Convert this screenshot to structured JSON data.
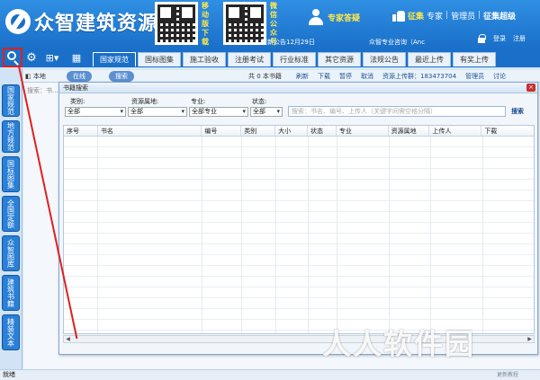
{
  "header": {
    "logo_text": "众智建筑资源",
    "qr1_label": "移动版下载",
    "qr2_label": "微信公众号",
    "expert_label": "专家答疑",
    "recruit_label": "征集",
    "recruit_expert": "专家",
    "recruit_admin": "管理员",
    "recruit_super": "征集超级",
    "notice": "更新公告12月29日",
    "company": "众智专业咨询（Anc",
    "login": "登录",
    "register": "注册"
  },
  "nav": {
    "tabs": [
      "国家规范",
      "国标图集",
      "施工验收",
      "注册考试",
      "行业标准",
      "其它资源",
      "法规公告",
      "最近上传",
      "有奖上传"
    ],
    "active": 0
  },
  "subbar": {
    "tab_label": "本地",
    "online_label": "在线",
    "search_label": "搜索",
    "count_text": "共 0 本书籍",
    "actions": [
      "刷新",
      "下载",
      "暂停",
      "取消"
    ],
    "uploader_label": "资源上传群：183473704",
    "admin_label": "管理员",
    "discuss_label": "讨论"
  },
  "sidebar": {
    "tabs": [
      "国家规范",
      "地方规范",
      "国标图集",
      "全国定额",
      "众智图库",
      "建筑书籍",
      "精装文本"
    ]
  },
  "background": {
    "search_placeholder": "搜索：书..."
  },
  "dialog": {
    "title": "书籍搜索",
    "close": "×",
    "filters": {
      "category_label": "类别:",
      "category_value": "全部",
      "region_label": "资源属地:",
      "region_value": "全部",
      "major_label": "专业:",
      "major_value": "全部专业",
      "status_label": "状态:",
      "status_value": "全部",
      "search_placeholder": "搜索：书名、编号、上传人（关键字间需空格分隔）",
      "search_button": "搜索"
    },
    "columns": [
      "序号",
      "书名",
      "编号",
      "类别",
      "大小",
      "状态",
      "专业",
      "资源属地",
      "上传人",
      "下载"
    ]
  },
  "status": {
    "text": "就绪"
  },
  "watermark": {
    "text": "人人软件园",
    "small": "更新教程"
  },
  "colors": {
    "header_blue": "#1a6fc8",
    "accent_yellow": "#ffe84d",
    "highlight_red": "#e02020"
  }
}
